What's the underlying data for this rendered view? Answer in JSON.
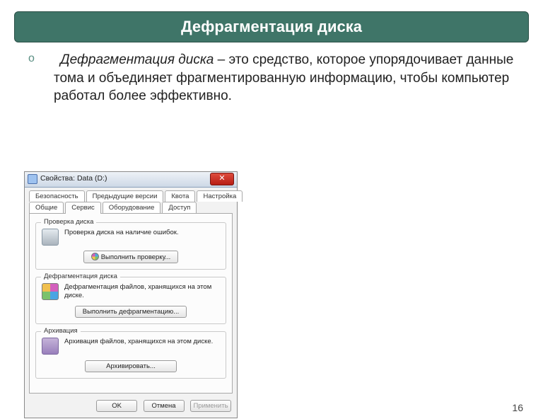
{
  "slide": {
    "title": "Дефрагментация диска",
    "bullet": "o",
    "term_italic": "Дефрагментация диска",
    "term_tail": " – это средство, которое упорядочивает данные тома и объединяет фрагментированную информацию, чтобы компьютер работал более эффективно.",
    "page_number": "16"
  },
  "dialog": {
    "title": "Свойства: Data (D:)",
    "close_glyph": "✕",
    "tabs_row1": [
      "Безопасность",
      "Предыдущие версии",
      "Квота",
      "Настройка"
    ],
    "tabs_row2": [
      "Общие",
      "Сервис",
      "Оборудование",
      "Доступ"
    ],
    "active_tab": "Сервис",
    "groups": {
      "check": {
        "title": "Проверка диска",
        "text": "Проверка диска на наличие ошибок.",
        "button": "Выполнить проверку..."
      },
      "defrag": {
        "title": "Дефрагментация диска",
        "text": "Дефрагментация файлов, хранящихся на этом диске.",
        "button": "Выполнить дефрагментацию..."
      },
      "archive": {
        "title": "Архивация",
        "text": "Архивация файлов, хранящихся на этом диске.",
        "button": "Архивировать..."
      }
    },
    "footer": {
      "ok": "OK",
      "cancel": "Отмена",
      "apply": "Применить"
    }
  }
}
